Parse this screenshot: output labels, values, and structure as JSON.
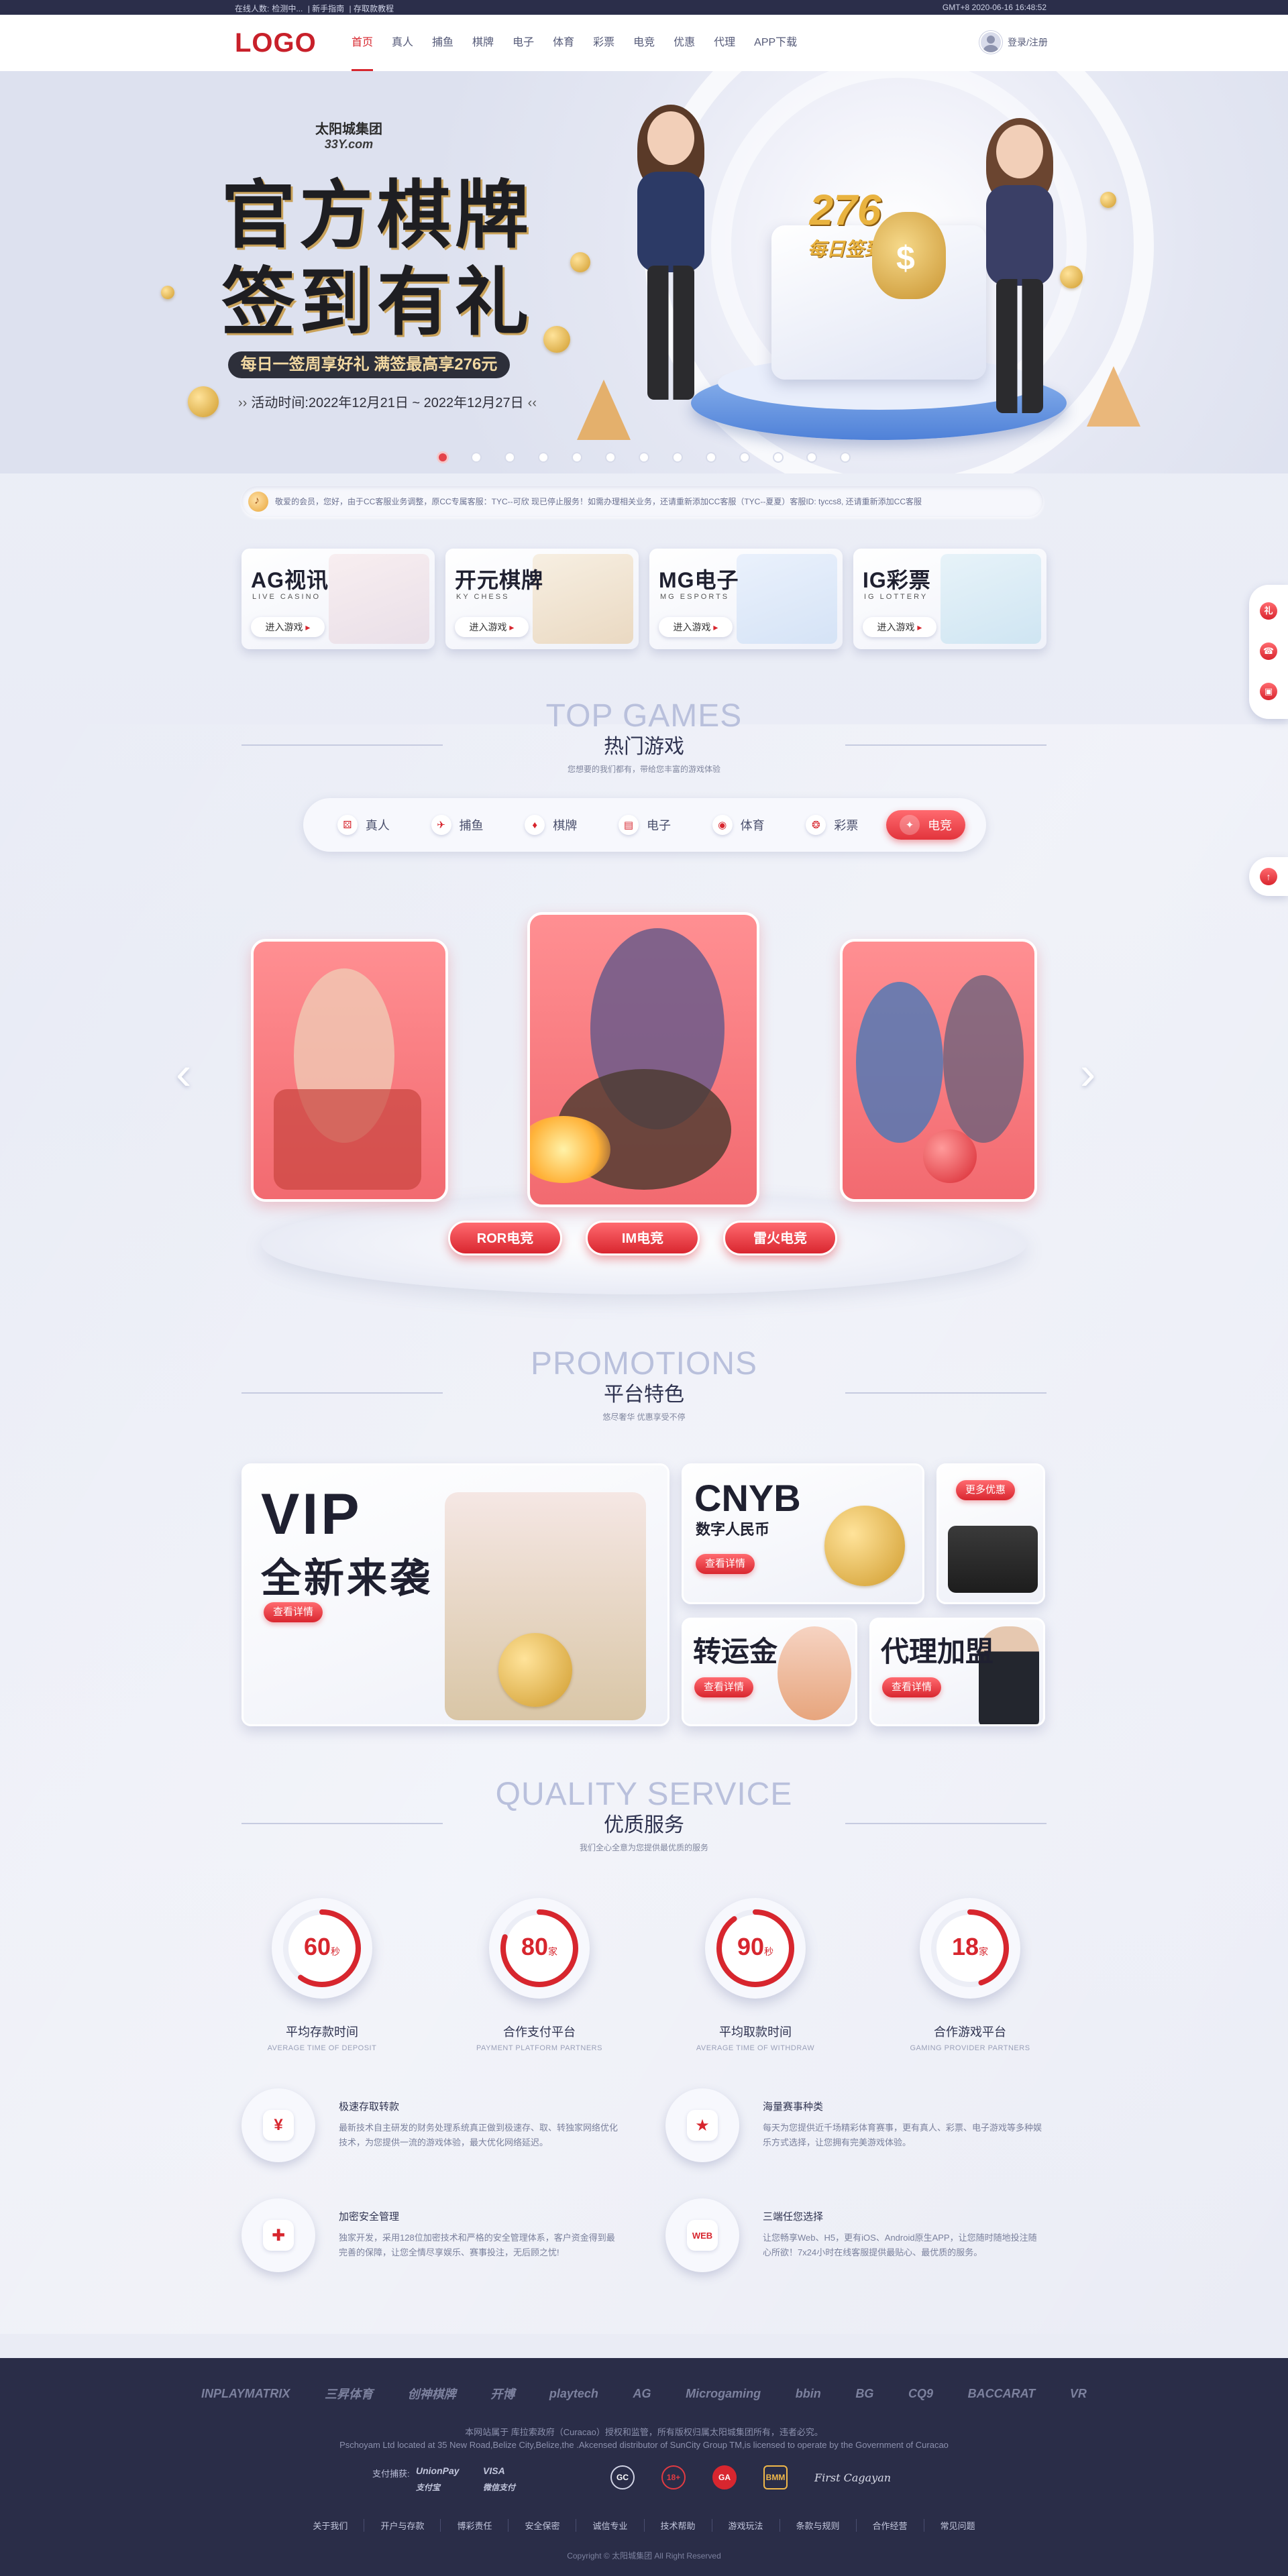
{
  "topbar": {
    "online_label": "在线人数:",
    "online_value": "检测中...",
    "guide": "新手指南",
    "deposit_info": "存取款教程",
    "clock": "GMT+8 2020-06-16  16:48:52"
  },
  "nav": {
    "logo": "LOGO",
    "items": [
      "首页",
      "真人",
      "捕鱼",
      "棋牌",
      "电子",
      "体育",
      "彩票",
      "电竞",
      "优惠",
      "代理",
      "APP下载"
    ],
    "user_link": "登录/注册"
  },
  "hero": {
    "brand_cn": "太阳城集团",
    "brand_en": "33Y.com",
    "title_line1": "官方棋牌",
    "title_line2": "签到有礼",
    "subtitle": "每日一签周享好礼 满签最高享276元",
    "date": "活动时间:2022年12月21日 ~ 2022年12月27日",
    "badge_number": "276",
    "badge_text": "每日签到",
    "slide_count": 13,
    "active_slide": 0
  },
  "notice": {
    "text": "敬爱的会员，您好，由于CC客服业务调整，原CC专属客服：TYC--可欣 现已停止服务！如需办理相关业务，还请重新添加CC客服（TYC--夏夏）客服ID: tyccs8, 还请重新添加CC客服"
  },
  "game_cards": [
    {
      "title": "AG视讯",
      "subtitle": "LIVE CASINO",
      "button": "进入游戏",
      "color": "#f3e6e8"
    },
    {
      "title": "开元棋牌",
      "subtitle": "KY CHESS",
      "button": "进入游戏",
      "color": "#f4ead9"
    },
    {
      "title": "MG电子",
      "subtitle": "MG ESPORTS",
      "button": "进入游戏",
      "color": "#e5eefb"
    },
    {
      "title": "IG彩票",
      "subtitle": "IG LOTTERY",
      "button": "进入游戏",
      "color": "#e3f0f7"
    }
  ],
  "top_games": {
    "en": "TOP GAMES",
    "cn": "热门游戏",
    "desc": "您想要的我们都有，带给您丰富的游戏体验",
    "tabs": [
      {
        "label": "真人",
        "icon": "dice-icon"
      },
      {
        "label": "捕鱼",
        "icon": "fish-icon"
      },
      {
        "label": "棋牌",
        "icon": "card-icon"
      },
      {
        "label": "电子",
        "icon": "slot-icon"
      },
      {
        "label": "体育",
        "icon": "ball-icon"
      },
      {
        "label": "彩票",
        "icon": "lottery-icon"
      },
      {
        "label": "电竞",
        "icon": "gamepad-icon"
      }
    ],
    "active_tab": 6,
    "carousel_buttons": [
      "ROR电竞",
      "IM电竞",
      "雷火电竞"
    ]
  },
  "promotions": {
    "en": "PROMOTIONS",
    "cn": "平台特色",
    "desc": "悠尽奢华 优惠享受不停",
    "vip_title1": "VIP",
    "vip_title2": "全新来袭",
    "cnyb_title": "CNYB",
    "cnyb_sub": "数字人民币",
    "zyj_title": "转运金",
    "agent_title": "代理加盟",
    "more_button": "更多优惠",
    "detail_button": "查看详情"
  },
  "service": {
    "en": "QUALITY SERVICE",
    "cn": "优质服务",
    "desc": "我们全心全意为您提供最优质的服务",
    "stats": [
      {
        "value": "60",
        "unit": "秒",
        "label": "平均存款时间",
        "en": "AVERAGE TIME OF DEPOSIT",
        "fraction": 0.6
      },
      {
        "value": "80",
        "unit": "家",
        "label": "合作支付平台",
        "en": "PAYMENT PLATFORM PARTNERS",
        "fraction": 0.8
      },
      {
        "value": "90",
        "unit": "秒",
        "label": "平均取款时间",
        "en": "AVERAGE TIME OF WITHDRAW",
        "fraction": 0.9
      },
      {
        "value": "18",
        "unit": "家",
        "label": "合作游戏平台",
        "en": "GAMING PROVIDER PARTNERS",
        "fraction": 0.45
      }
    ],
    "features": [
      {
        "title": "极速存取转款",
        "desc": "最新技术自主研发的财务处理系统真正做到极速存、取、转独家网络优化技术，为您提供一流的游戏体验，最大优化网络延迟。",
        "icon": "moneybag-icon"
      },
      {
        "title": "海量赛事种类",
        "desc": "每天为您提供近千场精彩体育赛事，更有真人、彩票、电子游戏等多种娱乐方式选择，让您拥有完美游戏体验。",
        "icon": "trophy-icon"
      },
      {
        "title": "加密安全管理",
        "desc": "独家开发，采用128位加密技术和严格的安全管理体系，客户资金得到最完善的保障，让您全情尽享娱乐、赛事投注，无后顾之忧!",
        "icon": "shield-icon"
      },
      {
        "title": "三端任您选择",
        "desc": "让您畅享Web、H5，更有iOS、Android原生APP，让您随时随地投注随心所欲！7x24小时在线客服提供最贴心、最优质的服务。",
        "icon": "web-icon"
      }
    ]
  },
  "footer": {
    "partners": [
      "INPLAYMATRIX",
      "三昇体育",
      "创神棋牌",
      "开博",
      "playtech",
      "AG",
      "Microgaming",
      "bbin",
      "BG",
      "CQ9",
      "BACCARAT",
      "VR"
    ],
    "line1": "本网站属于 库拉索政府（Curacao）授权和监管，所有版权归属太阳城集团所有，违者必究。",
    "line2": "Pschoyam Ltd located at 35 New Road,Belize City,Belize,the .Akcensed distributor of SunCity Group TM,is licensed to operate by the Government of Curacao",
    "pay_label": "支付捕获:",
    "pay_logos": [
      "UnionPay",
      "VISA",
      "支付宝",
      "微信支付"
    ],
    "licenses": [
      "GC",
      "18+",
      "GA",
      "BMM",
      "First Cagayan"
    ],
    "links": [
      "关于我们",
      "开户与存款",
      "博彩责任",
      "安全保密",
      "诚信专业",
      "技术帮助",
      "游戏玩法",
      "条款与规则",
      "合作经营",
      "常见问题"
    ],
    "copyright": "Copyright © 太阳城集团 All Right Reserved"
  },
  "float": {
    "icons": [
      "gift-icon",
      "service-icon",
      "app-icon"
    ],
    "bottom_icon": "top-icon"
  },
  "colors": {
    "accent": "#d7262e",
    "footer_bg": "#2a2d48",
    "page_bg": "#eceef7"
  }
}
